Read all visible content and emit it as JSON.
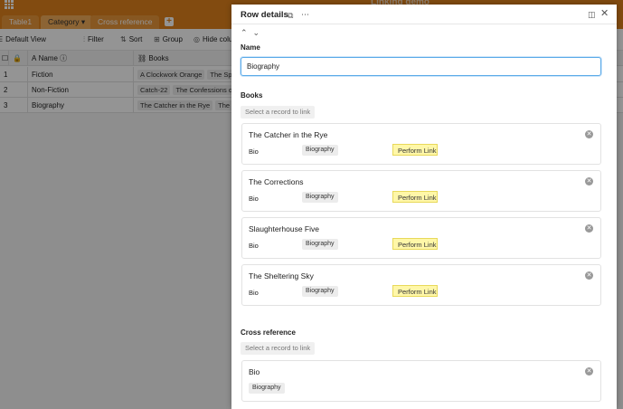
{
  "app": {
    "title": "Linking demo"
  },
  "tabs": [
    {
      "label": "Table1"
    },
    {
      "label": "Category"
    },
    {
      "label": "Cross reference"
    }
  ],
  "toolbar": {
    "view": "Default View",
    "filter": "Filter",
    "sort": "Sort",
    "group": "Group",
    "hide": "Hide colu"
  },
  "grid": {
    "columns": [
      {
        "label": "Name"
      },
      {
        "label": "Books"
      }
    ],
    "rows": [
      {
        "num": "1",
        "name": "Fiction",
        "books": [
          "A Clockwork Orange",
          "The Spy W"
        ]
      },
      {
        "num": "2",
        "name": "Non-Fiction",
        "books": [
          "Catch-22",
          "The Confessions of N"
        ]
      },
      {
        "num": "3",
        "name": "Biography",
        "books": [
          "The Catcher in the Rye",
          "The Co"
        ]
      }
    ],
    "add": "+"
  },
  "panel": {
    "title": "Row details",
    "name_label": "Name",
    "name_value": "Biography",
    "books_label": "Books",
    "link_placeholder": "Select a record to link",
    "books": [
      {
        "title": "The Catcher in the Rye",
        "field": "Bio",
        "chip": "Biography",
        "action": "Perform Link"
      },
      {
        "title": "The Corrections",
        "field": "Bio",
        "chip": "Biography",
        "action": "Perform Link"
      },
      {
        "title": "Slaughterhouse Five",
        "field": "Bio",
        "chip": "Biography",
        "action": "Perform Link"
      },
      {
        "title": "The Sheltering Sky",
        "field": "Bio",
        "chip": "Biography",
        "action": "Perform Link"
      }
    ],
    "cross_label": "Cross reference",
    "cross_placeholder": "Select a record to link",
    "cross": [
      {
        "title": "Bio",
        "chip": "Biography"
      }
    ]
  }
}
